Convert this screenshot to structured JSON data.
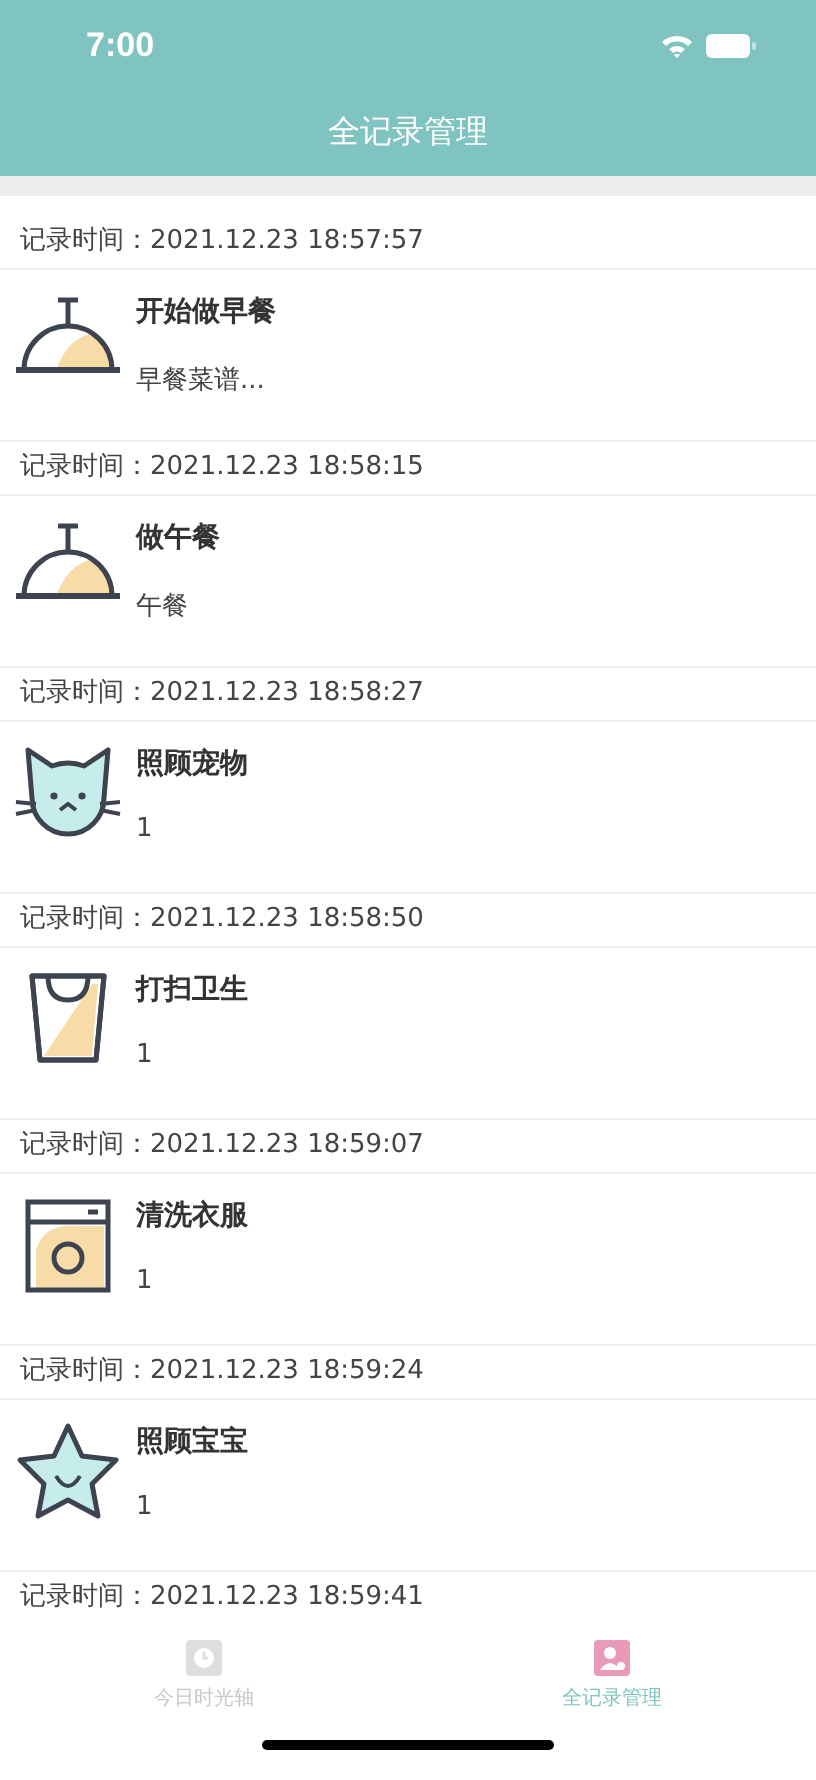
{
  "status_bar": {
    "time": "7:00"
  },
  "nav": {
    "title": "全记录管理"
  },
  "records": [
    {
      "time": "记录时间：2021.12.23 18:57:57",
      "title": "开始做早餐",
      "note": "早餐菜谱...",
      "kind": "cloche"
    },
    {
      "time": "记录时间：2021.12.23 18:58:15",
      "title": "做午餐",
      "note": "午餐",
      "kind": "cloche"
    },
    {
      "time": "记录时间：2021.12.23 18:58:27",
      "title": "照顾宠物",
      "note": "1",
      "kind": "cat"
    },
    {
      "time": "记录时间：2021.12.23 18:58:50",
      "title": "打扫卫生",
      "note": "1",
      "kind": "bag"
    },
    {
      "time": "记录时间：2021.12.23 18:59:07",
      "title": "清洗衣服",
      "note": "1",
      "kind": "washer"
    },
    {
      "time": "记录时间：2021.12.23 18:59:24",
      "title": "照顾宝宝",
      "note": "1",
      "kind": "star"
    },
    {
      "time": "记录时间：2021.12.23 18:59:41"
    }
  ],
  "tab_bar": [
    {
      "label": "今日时光轴",
      "kind": "clock",
      "selected": false
    },
    {
      "label": "全记录管理",
      "kind": "person",
      "selected": true
    }
  ]
}
